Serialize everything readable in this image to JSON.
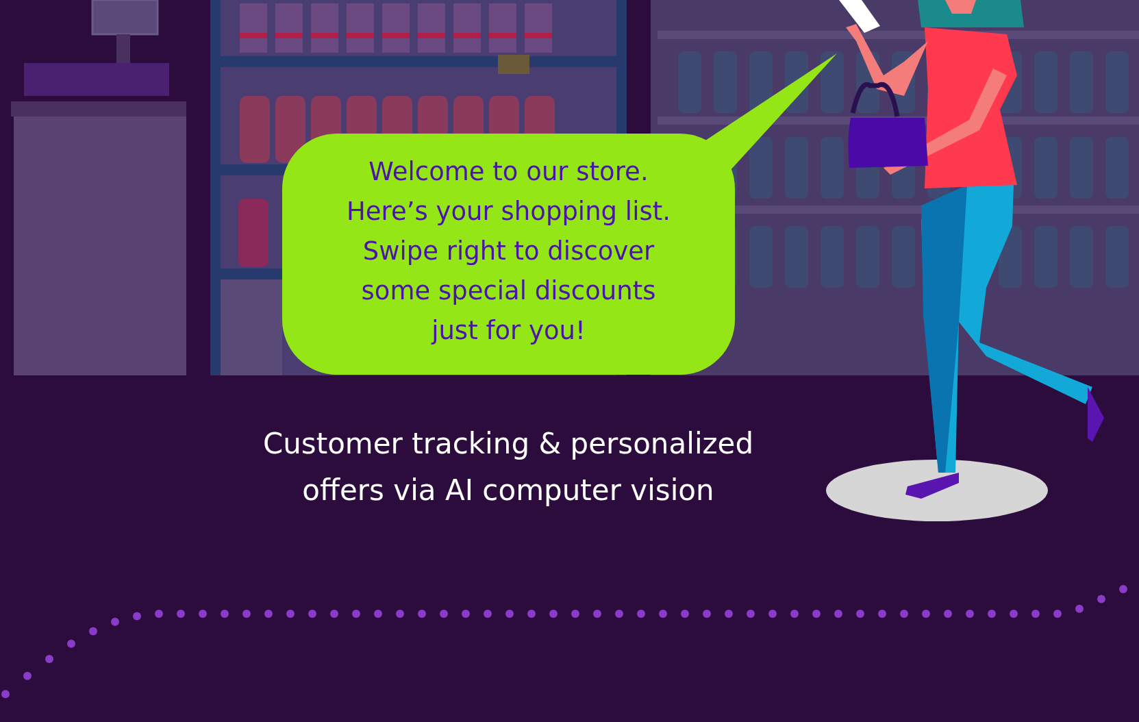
{
  "speech_bubble": {
    "text": "Welcome to our store.\nHere’s your shopping list.\nSwipe right to discover\nsome special discounts\njust for you!"
  },
  "caption": {
    "text": "Customer tracking & personalized\noffers via AI computer vision"
  }
}
